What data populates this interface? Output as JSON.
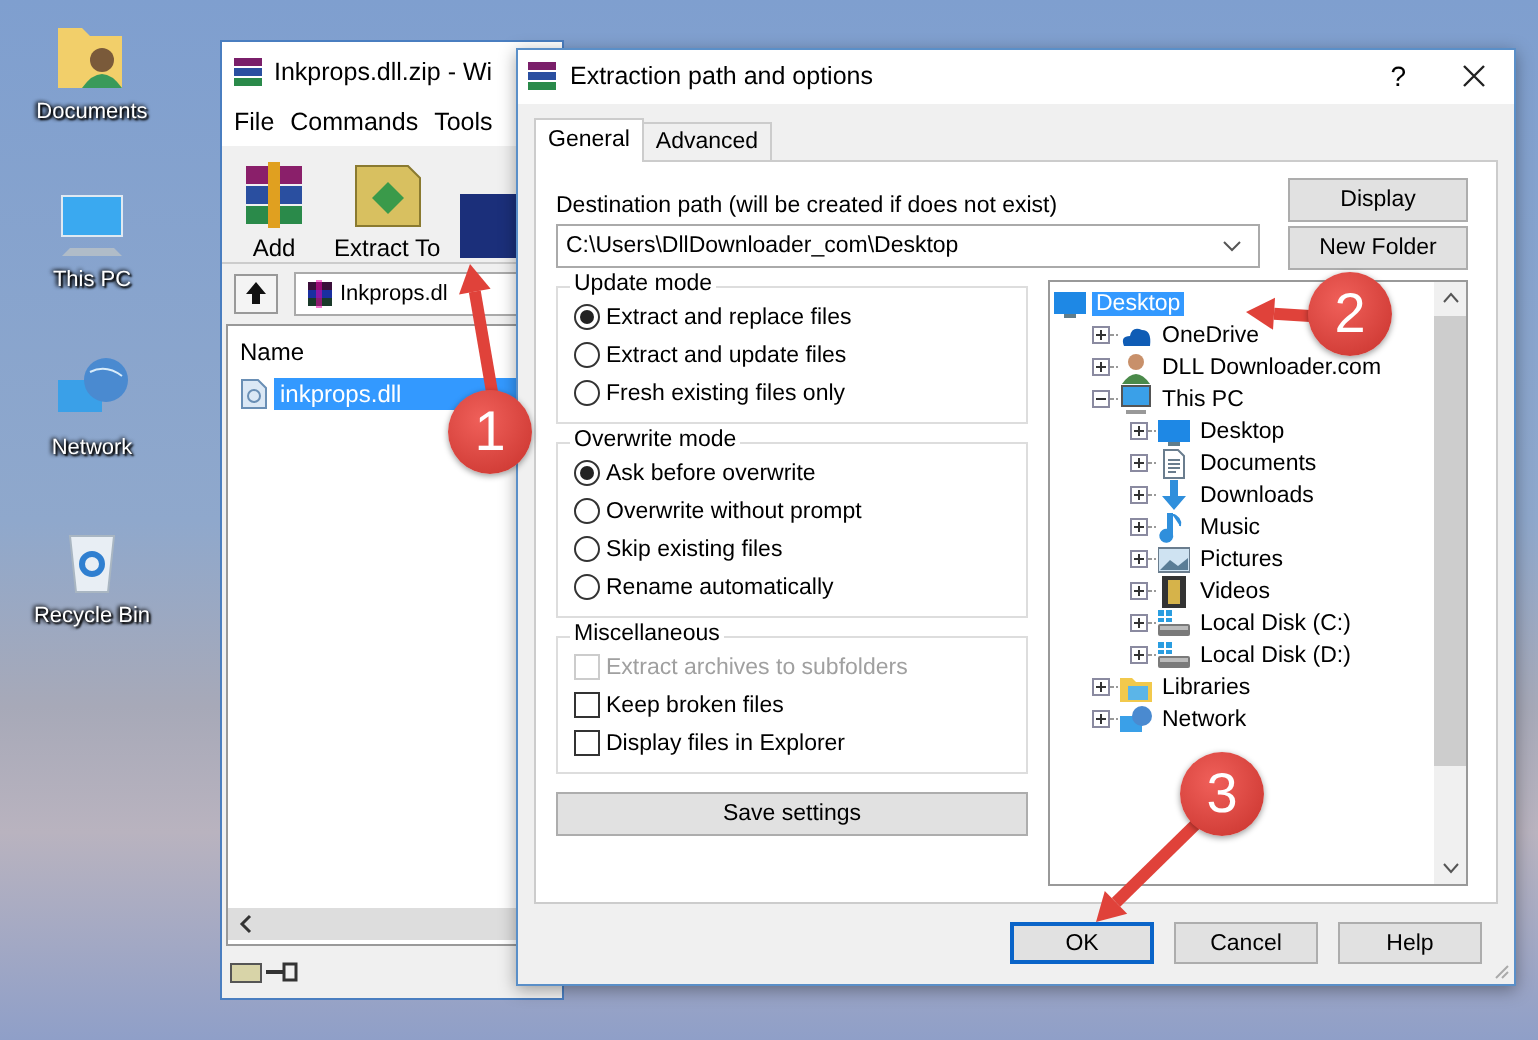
{
  "desktop_icons": [
    {
      "label": "Documents",
      "kind": "documents"
    },
    {
      "label": "This PC",
      "kind": "pc"
    },
    {
      "label": "Network",
      "kind": "network"
    },
    {
      "label": "Recycle Bin",
      "kind": "recycle"
    }
  ],
  "main_window": {
    "title": "Inkprops.dll.zip - Wi",
    "menu": [
      "File",
      "Commands",
      "Tools"
    ],
    "toolbar": [
      {
        "label": "Add",
        "kind": "add"
      },
      {
        "label": "Extract To",
        "kind": "extract"
      },
      {
        "kind": "book"
      }
    ],
    "address": "Inkprops.dl",
    "columns": [
      "Name"
    ],
    "files": [
      {
        "name": "inkprops.dll",
        "selected": true
      }
    ]
  },
  "dialog": {
    "title": "Extraction path and options",
    "help_button": "?",
    "tabs": [
      {
        "label": "General",
        "selected": true
      },
      {
        "label": "Advanced",
        "selected": false
      }
    ],
    "destination": {
      "label": "Destination path (will be created if does not exist)",
      "value": "C:\\Users\\DllDownloader_com\\Desktop"
    },
    "side_buttons": [
      "Display",
      "New Folder"
    ],
    "groups": [
      {
        "title": "Update mode",
        "kind": "radio",
        "options": [
          {
            "label": "Extract and replace files",
            "selected": true
          },
          {
            "label": "Extract and update files",
            "selected": false
          },
          {
            "label": "Fresh existing files only",
            "selected": false
          }
        ]
      },
      {
        "title": "Overwrite mode",
        "kind": "radio",
        "options": [
          {
            "label": "Ask before overwrite",
            "selected": true
          },
          {
            "label": "Overwrite without prompt",
            "selected": false
          },
          {
            "label": "Skip existing files",
            "selected": false
          },
          {
            "label": "Rename automatically",
            "selected": false
          }
        ]
      },
      {
        "title": "Miscellaneous",
        "kind": "checkbox",
        "options": [
          {
            "label": "Extract archives to subfolders",
            "checked": false,
            "disabled": true
          },
          {
            "label": "Keep broken files",
            "checked": false,
            "disabled": false
          },
          {
            "label": "Display files in Explorer",
            "checked": false,
            "disabled": false
          }
        ]
      }
    ],
    "save_button": "Save settings",
    "tree": [
      {
        "label": "Desktop",
        "kind": "desktop",
        "selected": true,
        "children": [
          {
            "label": "OneDrive",
            "kind": "cloud",
            "selected": false,
            "expanded": false
          },
          {
            "label": "DLL Downloader.com",
            "kind": "user",
            "selected": false,
            "expanded": false
          },
          {
            "label": "This PC",
            "kind": "pc",
            "selected": false,
            "expanded": true,
            "children": [
              {
                "label": "Desktop",
                "kind": "desktop",
                "selected": false,
                "expanded": false
              },
              {
                "label": "Documents",
                "kind": "documents",
                "selected": false,
                "expanded": false
              },
              {
                "label": "Downloads",
                "kind": "downloads",
                "selected": false,
                "expanded": false
              },
              {
                "label": "Music",
                "kind": "music",
                "selected": false,
                "expanded": false
              },
              {
                "label": "Pictures",
                "kind": "pictures",
                "selected": false,
                "expanded": false
              },
              {
                "label": "Videos",
                "kind": "videos",
                "selected": false,
                "expanded": false
              },
              {
                "label": "Local Disk (C:)",
                "kind": "disk",
                "selected": false,
                "expanded": false
              },
              {
                "label": "Local Disk (D:)",
                "kind": "disk",
                "selected": false,
                "expanded": false
              }
            ]
          },
          {
            "label": "Libraries",
            "kind": "libraries",
            "selected": false,
            "expanded": false
          },
          {
            "label": "Network",
            "kind": "network",
            "selected": false,
            "expanded": false
          }
        ]
      }
    ],
    "buttons": [
      {
        "label": "OK",
        "default": true
      },
      {
        "label": "Cancel",
        "default": false
      },
      {
        "label": "Help",
        "default": false
      }
    ]
  },
  "annotations": [
    {
      "label": "1"
    },
    {
      "label": "2"
    },
    {
      "label": "3"
    }
  ]
}
